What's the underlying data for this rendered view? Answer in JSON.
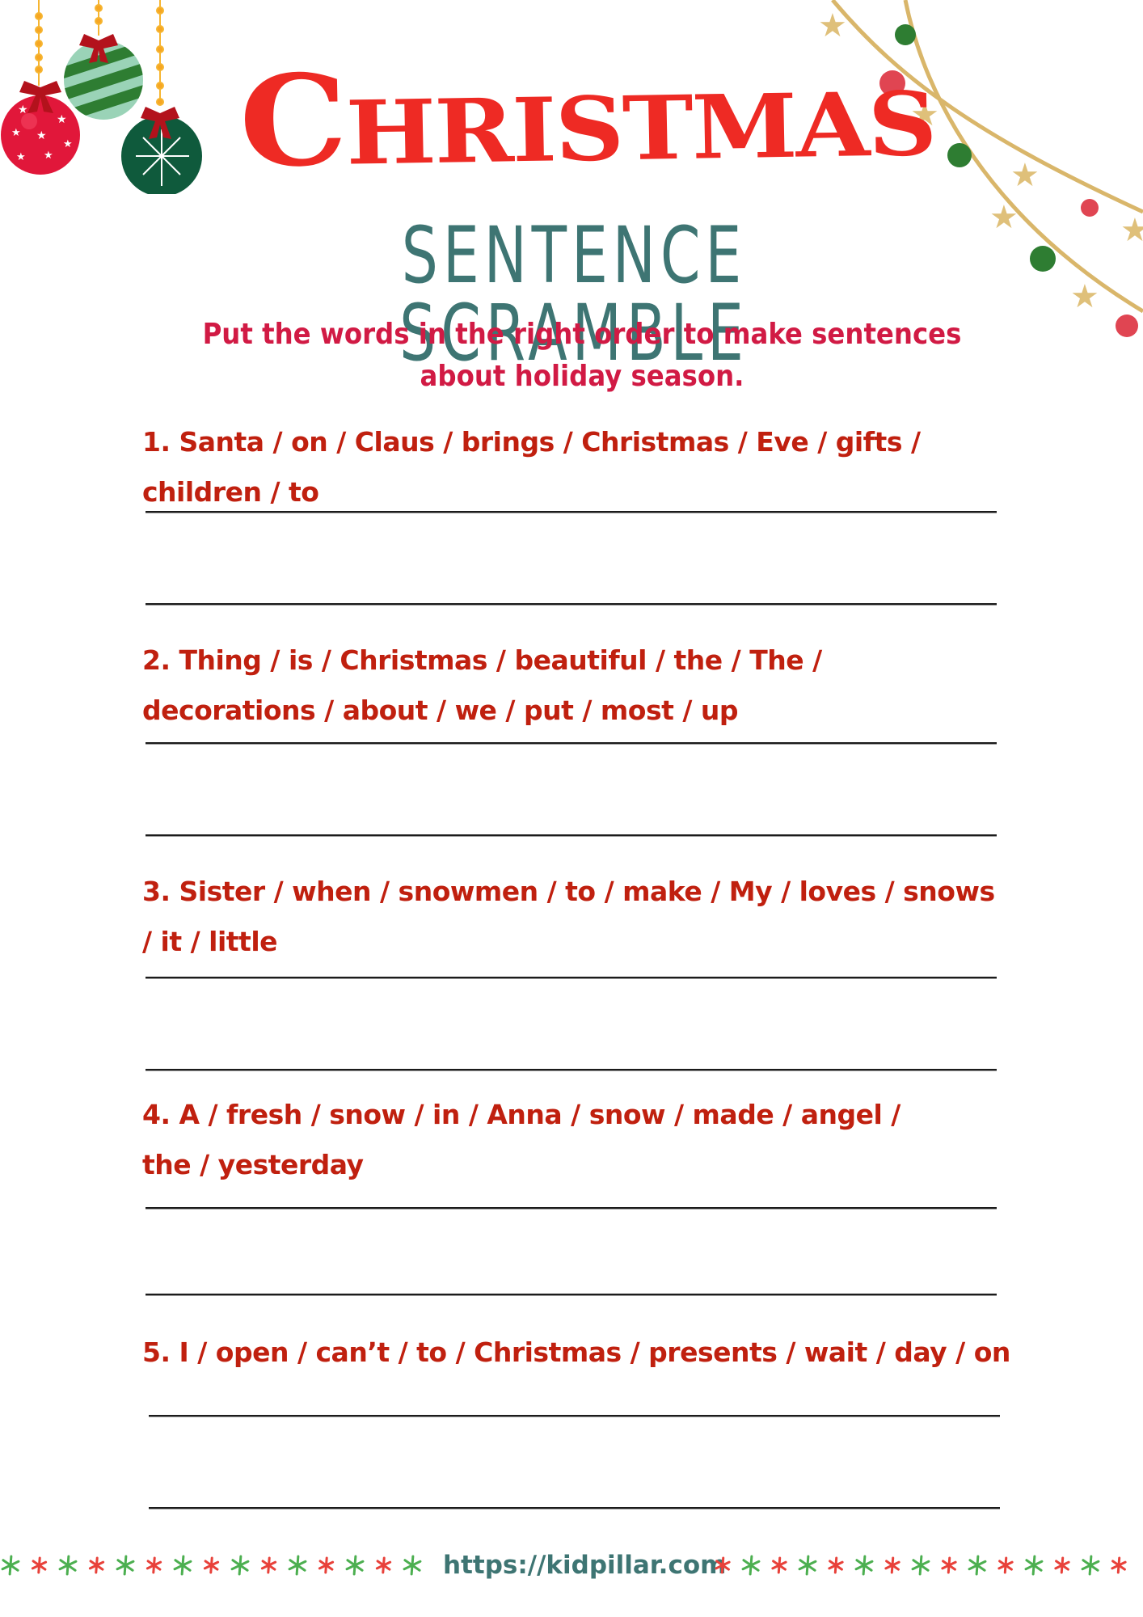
{
  "header": {
    "title": "Christmas",
    "subtitle": "SENTENCE SCRAMBLE",
    "instructions": "Put the words in the right order to make sentences about holiday season."
  },
  "questions": [
    {
      "number": "1.",
      "text": "1. Santa / on / Claus / brings / Christmas / Eve / gifts / children / to"
    },
    {
      "number": "2.",
      "text": "2. Thing / is / Christmas / beautiful / the / The / decorations / about / we / put / most / up"
    },
    {
      "number": "3.",
      "text": "3. Sister / when / snowmen / to / make / My / loves / snows / it / little"
    },
    {
      "number": "4.",
      "text": "4. A / fresh / snow / in / Anna / snow / made / angel / the / yesterday"
    },
    {
      "number": "5.",
      "text": "5. I / open / can’t / to / Christmas / presents / wait / day / on"
    }
  ],
  "footer": {
    "url": "https://kidpillar.com",
    "left_stars": 15,
    "right_stars": 15
  },
  "colors": {
    "title_red": "#ee2a24",
    "subtitle_teal": "#3e7573",
    "instruction_crimson": "#d11a44",
    "question_red": "#c0200f",
    "star_green": "#4caf50",
    "star_red": "#e8413a",
    "garland_gold": "#d9b66a"
  },
  "decorations": {
    "ornaments": [
      "red-star-bauble",
      "green-striped-bauble",
      "dark-green-snowflake-bauble"
    ],
    "garland": "gold-string-garland-with-stars-and-balls"
  }
}
